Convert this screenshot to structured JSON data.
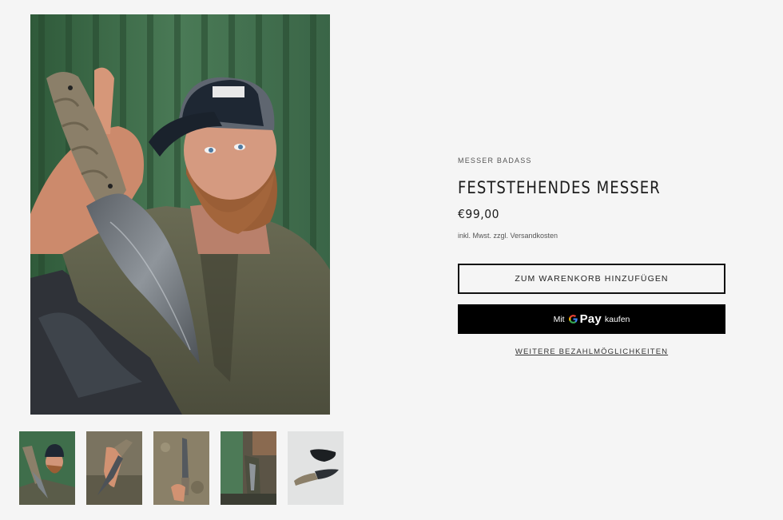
{
  "product": {
    "vendor": "MESSER BADASS",
    "title": "FESTSTEHENDES MESSER",
    "price": "€99,00",
    "tax_note": "inkl. Mwst. zzgl. Versandkosten"
  },
  "buttons": {
    "add_to_cart": "ZUM WARENKORB HINZUFÜGEN",
    "gpay_prefix": "Mit",
    "gpay_brand": "Pay",
    "gpay_suffix": "kaufen",
    "more_payment": "WEITERE BEZAHLMÖGLICHKEITEN"
  },
  "gallery": {
    "main_image": "photo-man-with-cap-holding-fixed-blade-knife",
    "thumbnails": [
      "thumb-man-holding-knife",
      "thumb-hand-holding-knife",
      "thumb-knife-on-ground",
      "thumb-knife-on-belt",
      "thumb-knife-with-sheath"
    ]
  },
  "colors": {
    "background": "#f5f5f5",
    "button_dark": "#000000",
    "text": "#1c1c1c"
  }
}
